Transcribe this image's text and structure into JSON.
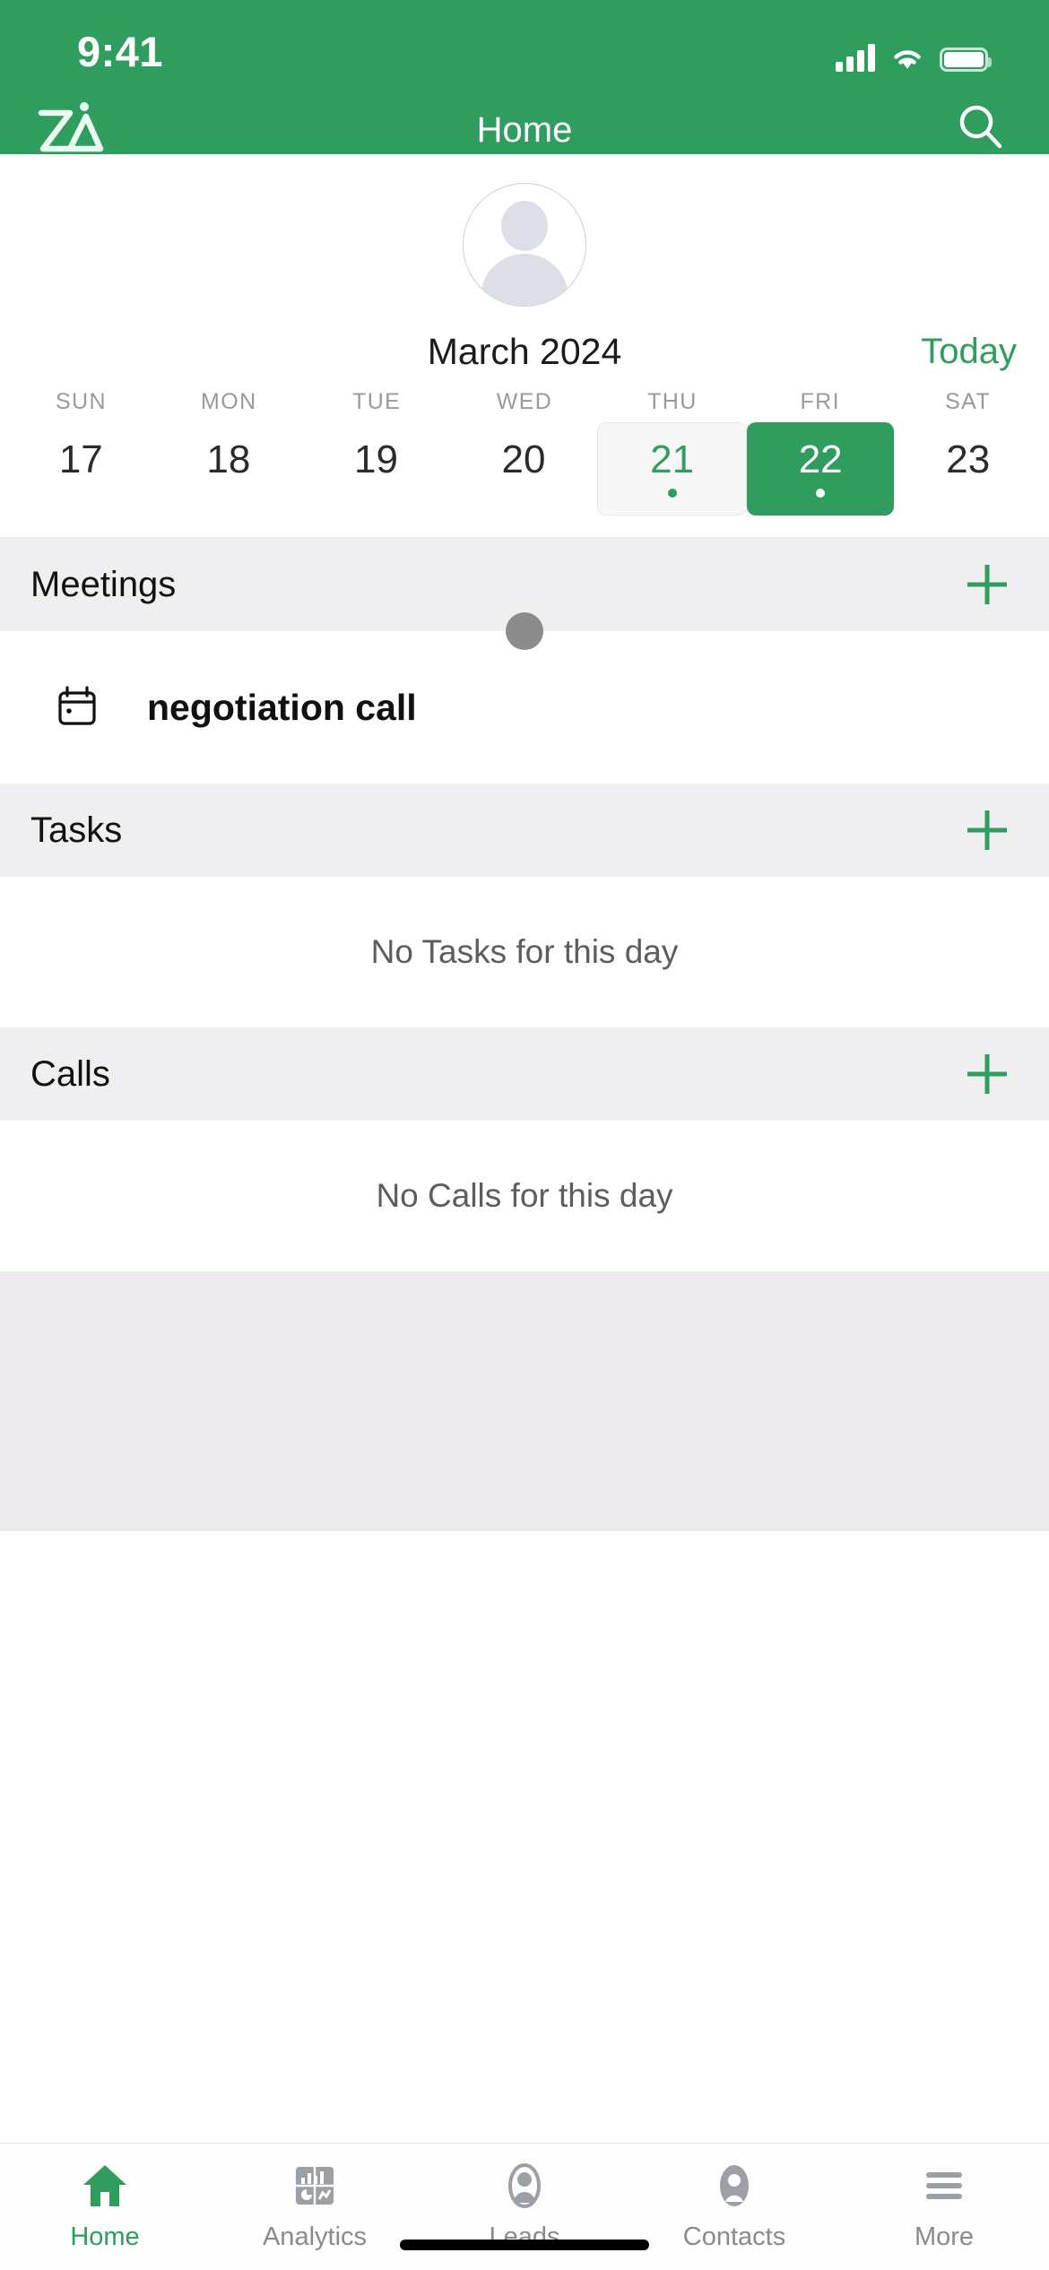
{
  "theme": {
    "brand_green": "#2E9D5E",
    "section_bg": "#efeef0",
    "muted_text": "#8b8b8b"
  },
  "status_bar": {
    "time": "9:41",
    "signal_icon": "cellular-signal-icon",
    "wifi_icon": "wifi-icon",
    "battery_icon": "battery-icon"
  },
  "nav_bar": {
    "logo_icon": "zia-logo-icon",
    "title": "Home",
    "search_icon": "search-icon"
  },
  "profile": {
    "avatar_icon": "default-avatar-icon"
  },
  "calendar": {
    "month_label": "March 2024",
    "today_button": "Today",
    "weekdays": [
      "SUN",
      "MON",
      "TUE",
      "WED",
      "THU",
      "FRI",
      "SAT"
    ],
    "days": [
      {
        "number": "17",
        "state": "normal",
        "has_event": false
      },
      {
        "number": "18",
        "state": "normal",
        "has_event": false
      },
      {
        "number": "19",
        "state": "normal",
        "has_event": false
      },
      {
        "number": "20",
        "state": "normal",
        "has_event": false
      },
      {
        "number": "21",
        "state": "today",
        "has_event": true
      },
      {
        "number": "22",
        "state": "selected",
        "has_event": true
      },
      {
        "number": "23",
        "state": "normal",
        "has_event": false
      }
    ]
  },
  "sections": [
    {
      "title": "Meetings",
      "add_icon": "plus-icon",
      "has_drag_handle": true,
      "items": [
        {
          "icon": "calendar-event-icon",
          "label": "negotiation call"
        }
      ],
      "empty_text": ""
    },
    {
      "title": "Tasks",
      "add_icon": "plus-icon",
      "has_drag_handle": false,
      "items": [],
      "empty_text": "No Tasks for this day"
    },
    {
      "title": "Calls",
      "add_icon": "plus-icon",
      "has_drag_handle": false,
      "items": [],
      "empty_text": "No Calls for this day"
    }
  ],
  "tab_bar": {
    "tabs": [
      {
        "label": "Home",
        "icon": "home-icon",
        "active": true
      },
      {
        "label": "Analytics",
        "icon": "analytics-icon",
        "active": false
      },
      {
        "label": "Leads",
        "icon": "leads-icon",
        "active": false
      },
      {
        "label": "Contacts",
        "icon": "contacts-icon",
        "active": false
      },
      {
        "label": "More",
        "icon": "hamburger-menu-icon",
        "active": false
      }
    ]
  }
}
